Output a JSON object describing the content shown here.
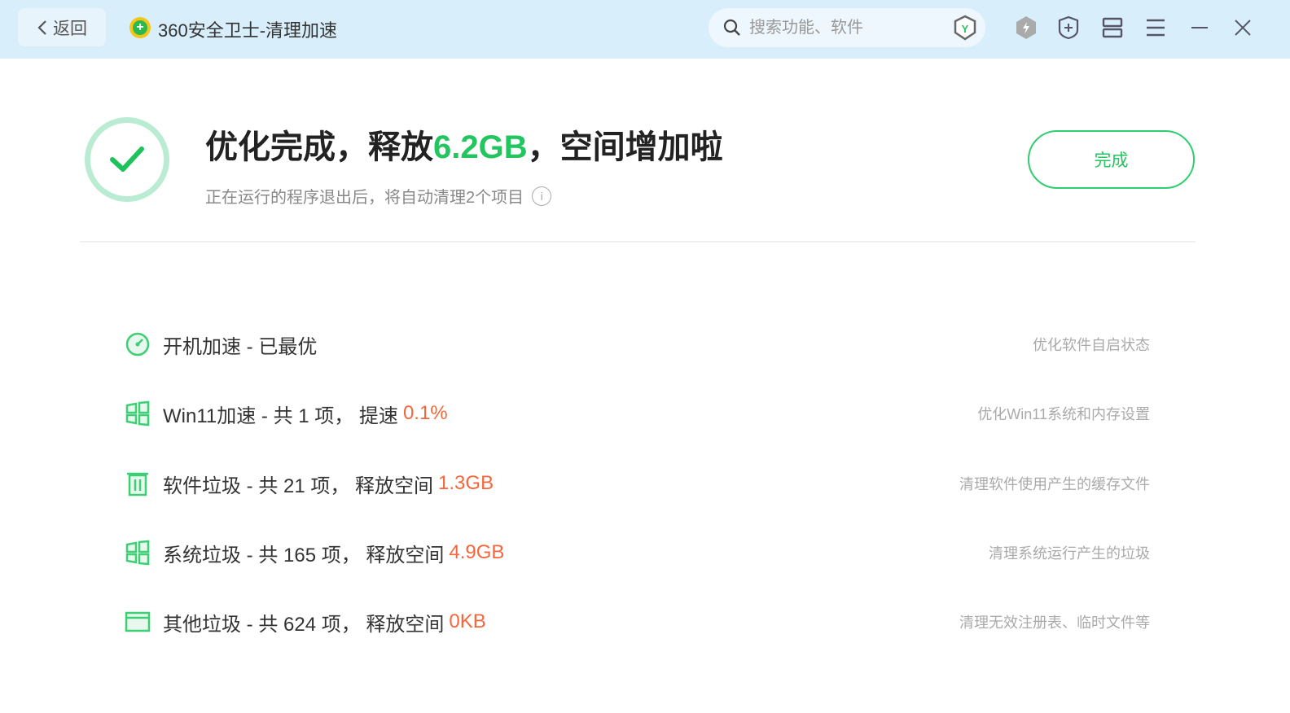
{
  "header": {
    "back_label": "返回",
    "app_title": "360安全卫士-清理加速",
    "search_placeholder": "搜索功能、软件"
  },
  "result": {
    "title_prefix": "优化完成，释放",
    "freed": "6.2GB",
    "title_suffix": "，空间增加啦",
    "subtitle": "正在运行的程序退出后，将自动清理2个项目",
    "done_label": "完成"
  },
  "items": [
    {
      "label": "开机加速 - 已最优",
      "value": "",
      "desc": "优化软件自启状态",
      "icon": "speedometer-icon"
    },
    {
      "label": "Win11加速 - 共 1 项， 提速",
      "value": "0.1%",
      "desc": "优化Win11系统和内存设置",
      "icon": "windows-icon"
    },
    {
      "label": "软件垃圾 - 共 21 项， 释放空间",
      "value": "1.3GB",
      "desc": "清理软件使用产生的缓存文件",
      "icon": "trash-icon"
    },
    {
      "label": "系统垃圾 - 共 165 项， 释放空间",
      "value": "4.9GB",
      "desc": "清理系统运行产生的垃圾",
      "icon": "windows-icon"
    },
    {
      "label": "其他垃圾 - 共 624 项， 释放空间",
      "value": "0KB",
      "desc": "清理无效注册表、临时文件等",
      "icon": "folder-icon"
    }
  ],
  "colors": {
    "accent": "#22c55e",
    "highlight": "#f5673a",
    "header_bg": "#d9eefb"
  }
}
